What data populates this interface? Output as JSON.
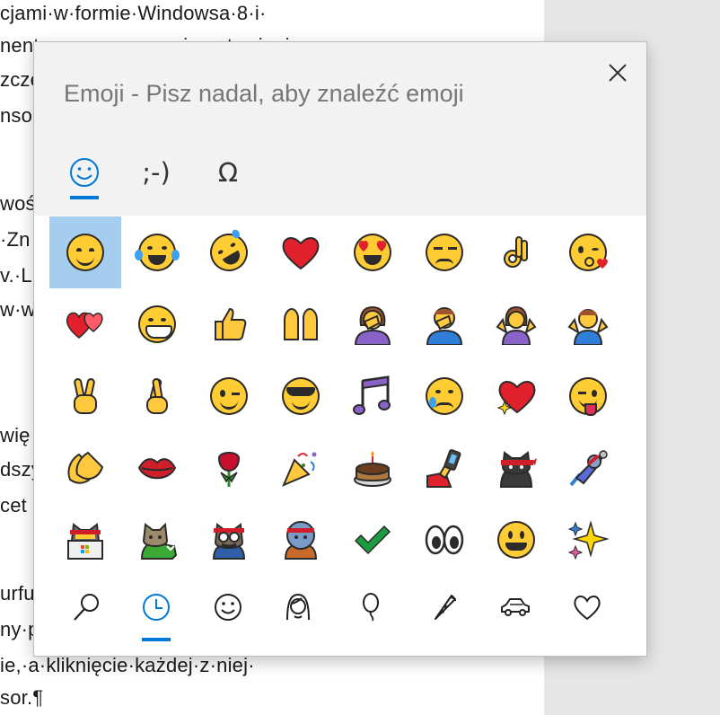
{
  "document": {
    "lines": [
      "cjami·w·formie·Windowsa·8·i·",
      "nentarnego·znaczenia·ustawienia",
      "zcze",
      "nso",
      "woś",
      "·Zn",
      "v.·Lu",
      "w·w",
      "wię",
      "dszy",
      "cet",
      "urfu",
      "ny·p",
      "ie,·a·kliknięcie·każdej·z·niej·",
      "sor.¶"
    ]
  },
  "panel": {
    "title": "Emoji - Pisz nadal, aby znaleźć emoji",
    "close_icon": "close-icon",
    "tabs": [
      {
        "name": "emoji",
        "icon": "smiley-face-icon",
        "label": "☺",
        "active": true
      },
      {
        "name": "kaomoji",
        "icon": "kaomoji-icon",
        "label": ";-)",
        "active": false
      },
      {
        "name": "symbols",
        "icon": "omega-icon",
        "label": "Ω",
        "active": false
      }
    ],
    "accent": "#0078d7",
    "selection_color": "#a4cdef",
    "emojis": [
      "smiling-face-with-smiling-eyes",
      "face-with-tears-of-joy",
      "rolling-on-floor-laughing",
      "red-heart",
      "smiling-face-with-heart-eyes",
      "unamused-face",
      "ok-hand",
      "face-blowing-kiss",
      "two-hearts",
      "grinning-face-with-big-eyes",
      "thumbs-up",
      "raising-hands",
      "woman-facepalming",
      "man-facepalming",
      "woman-shrugging",
      "man-shrugging",
      "victory-hand",
      "crossed-fingers",
      "winking-face",
      "smiling-face-with-sunglasses",
      "musical-notes",
      "crying-face",
      "sparkling-heart",
      "winking-face-with-tongue",
      "clapping-hands",
      "kiss-mark",
      "rose",
      "party-popper",
      "birthday-cake",
      "selfie",
      "ninja-cat",
      "astro-cat",
      "hacker-cat",
      "dino-cat",
      "hipster-cat",
      "stunt-cat",
      "check-mark",
      "eyes",
      "grinning-face",
      "sparkles"
    ],
    "categories": [
      {
        "name": "search",
        "icon": "search-icon",
        "active": false
      },
      {
        "name": "recent",
        "icon": "clock-icon",
        "active": true
      },
      {
        "name": "smileys",
        "icon": "smiley-outline-icon",
        "active": false
      },
      {
        "name": "people",
        "icon": "person-icon",
        "active": false
      },
      {
        "name": "celebration",
        "icon": "balloon-icon",
        "active": false
      },
      {
        "name": "food",
        "icon": "pizza-icon",
        "active": false
      },
      {
        "name": "transport",
        "icon": "car-icon",
        "active": false
      },
      {
        "name": "symbols",
        "icon": "heart-outline-icon",
        "active": false
      }
    ]
  }
}
